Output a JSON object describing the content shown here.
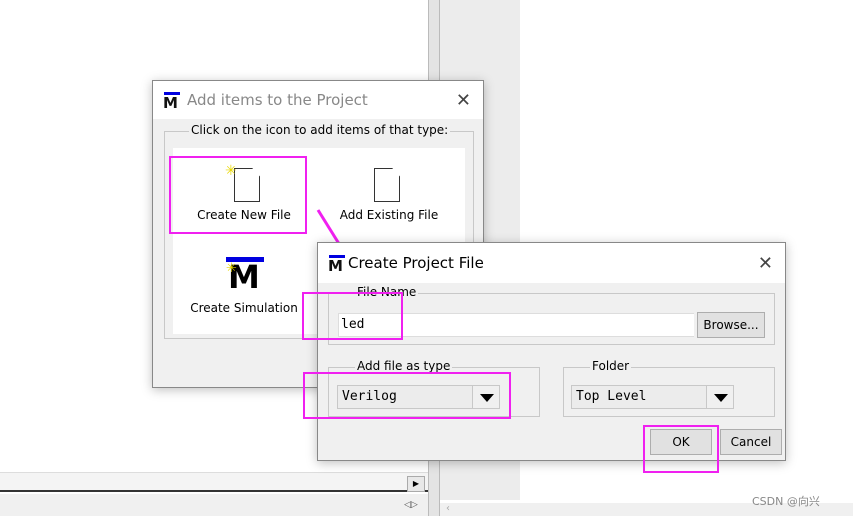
{
  "add_items_dialog": {
    "title": "Add items to the Project",
    "group_label": "Click on the icon to add items of that type:",
    "items": [
      {
        "label": "Create New File",
        "icon": "new-file-icon"
      },
      {
        "label": "Add Existing File",
        "icon": "file-icon"
      },
      {
        "label": "Create Simulation",
        "icon": "modelsim-logo-icon"
      }
    ]
  },
  "create_file_dialog": {
    "title": "Create Project File",
    "file_name_label": "File Name",
    "file_name_value": "led",
    "browse_label": "Browse...",
    "type_label": "Add file as type",
    "type_value": "Verilog",
    "folder_label": "Folder",
    "folder_value": "Top Level",
    "ok_label": "OK",
    "cancel_label": "Cancel"
  },
  "watermark": "CSDN @向兴",
  "colors": {
    "highlight": "#f020f0",
    "logo_bar": "#0000e0"
  }
}
